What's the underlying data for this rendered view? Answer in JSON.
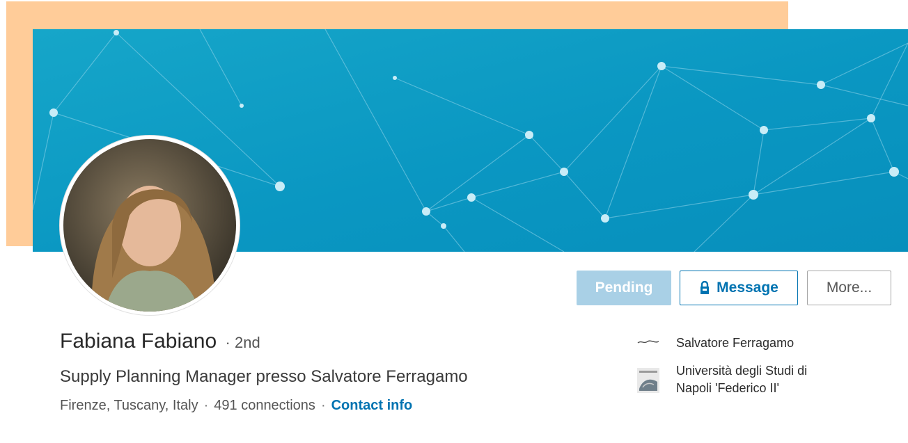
{
  "profile": {
    "name": "Fabiana Fabiano",
    "degree_sep": "·",
    "degree": "2nd",
    "headline": "Supply Planning Manager presso Salvatore Ferragamo",
    "location": "Firenze, Tuscany, Italy",
    "dot": "·",
    "connections": "491 connections",
    "contact_info": "Contact info"
  },
  "actions": {
    "pending": "Pending",
    "message": "Message",
    "more": "More..."
  },
  "affiliations": [
    {
      "name": "Salvatore Ferragamo",
      "logo": "ferragamo-logo"
    },
    {
      "name": "Università degli Studi di Napoli 'Federico II'",
      "name_line1": "Università degli Studi di",
      "name_line2": "Napoli 'Federico II'",
      "logo": "university-logo"
    }
  ],
  "colors": {
    "accent": "#0073b1",
    "banner": "#0e9cc6",
    "peach_background": "#ffcc99",
    "pending_bg": "#a9d0e6"
  }
}
